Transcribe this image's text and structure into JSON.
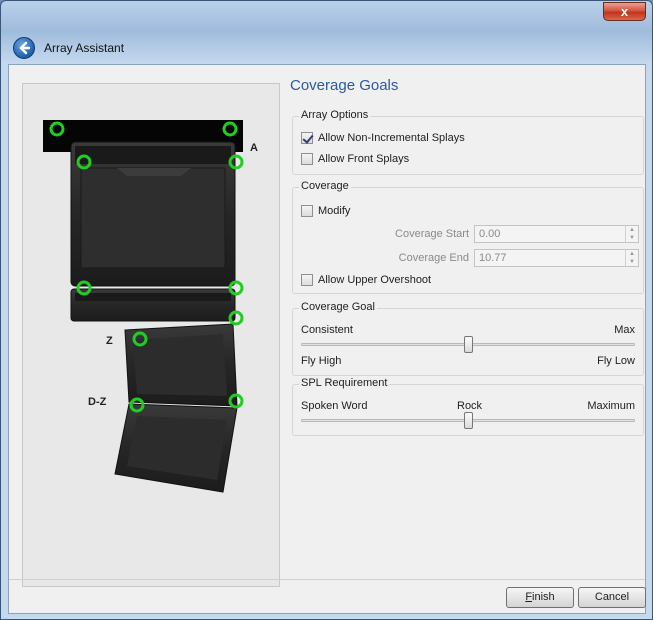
{
  "window": {
    "title": "Array Assistant",
    "close_label": "x"
  },
  "preview": {
    "labels": {
      "top": "A",
      "middle": "Z",
      "bottom": "D-Z"
    },
    "marker_color": "#22cc22"
  },
  "main": {
    "heading": "Coverage Goals",
    "array_options": {
      "title": "Array Options",
      "allow_non_incremental": {
        "label": "Allow Non-Incremental Splays",
        "checked": true
      },
      "allow_front": {
        "label": "Allow Front Splays",
        "checked": false
      }
    },
    "coverage": {
      "title": "Coverage",
      "modify": {
        "label": "Modify",
        "checked": false
      },
      "start": {
        "label": "Coverage Start",
        "value": "0.00"
      },
      "end": {
        "label": "Coverage End",
        "value": "10.77"
      },
      "allow_upper_overshoot": {
        "label": "Allow Upper Overshoot",
        "checked": false
      }
    },
    "coverage_goal": {
      "title": "Coverage Goal",
      "left_top": "Consistent",
      "right_top": "Max",
      "left_bottom": "Fly High",
      "right_bottom": "Fly Low",
      "value": 0.5
    },
    "spl_requirement": {
      "title": "SPL Requirement",
      "left": "Spoken Word",
      "center": "Rock",
      "right": "Maximum",
      "value": 0.5
    }
  },
  "footer": {
    "finish_first": "F",
    "finish_rest": "inish",
    "cancel": "Cancel"
  }
}
